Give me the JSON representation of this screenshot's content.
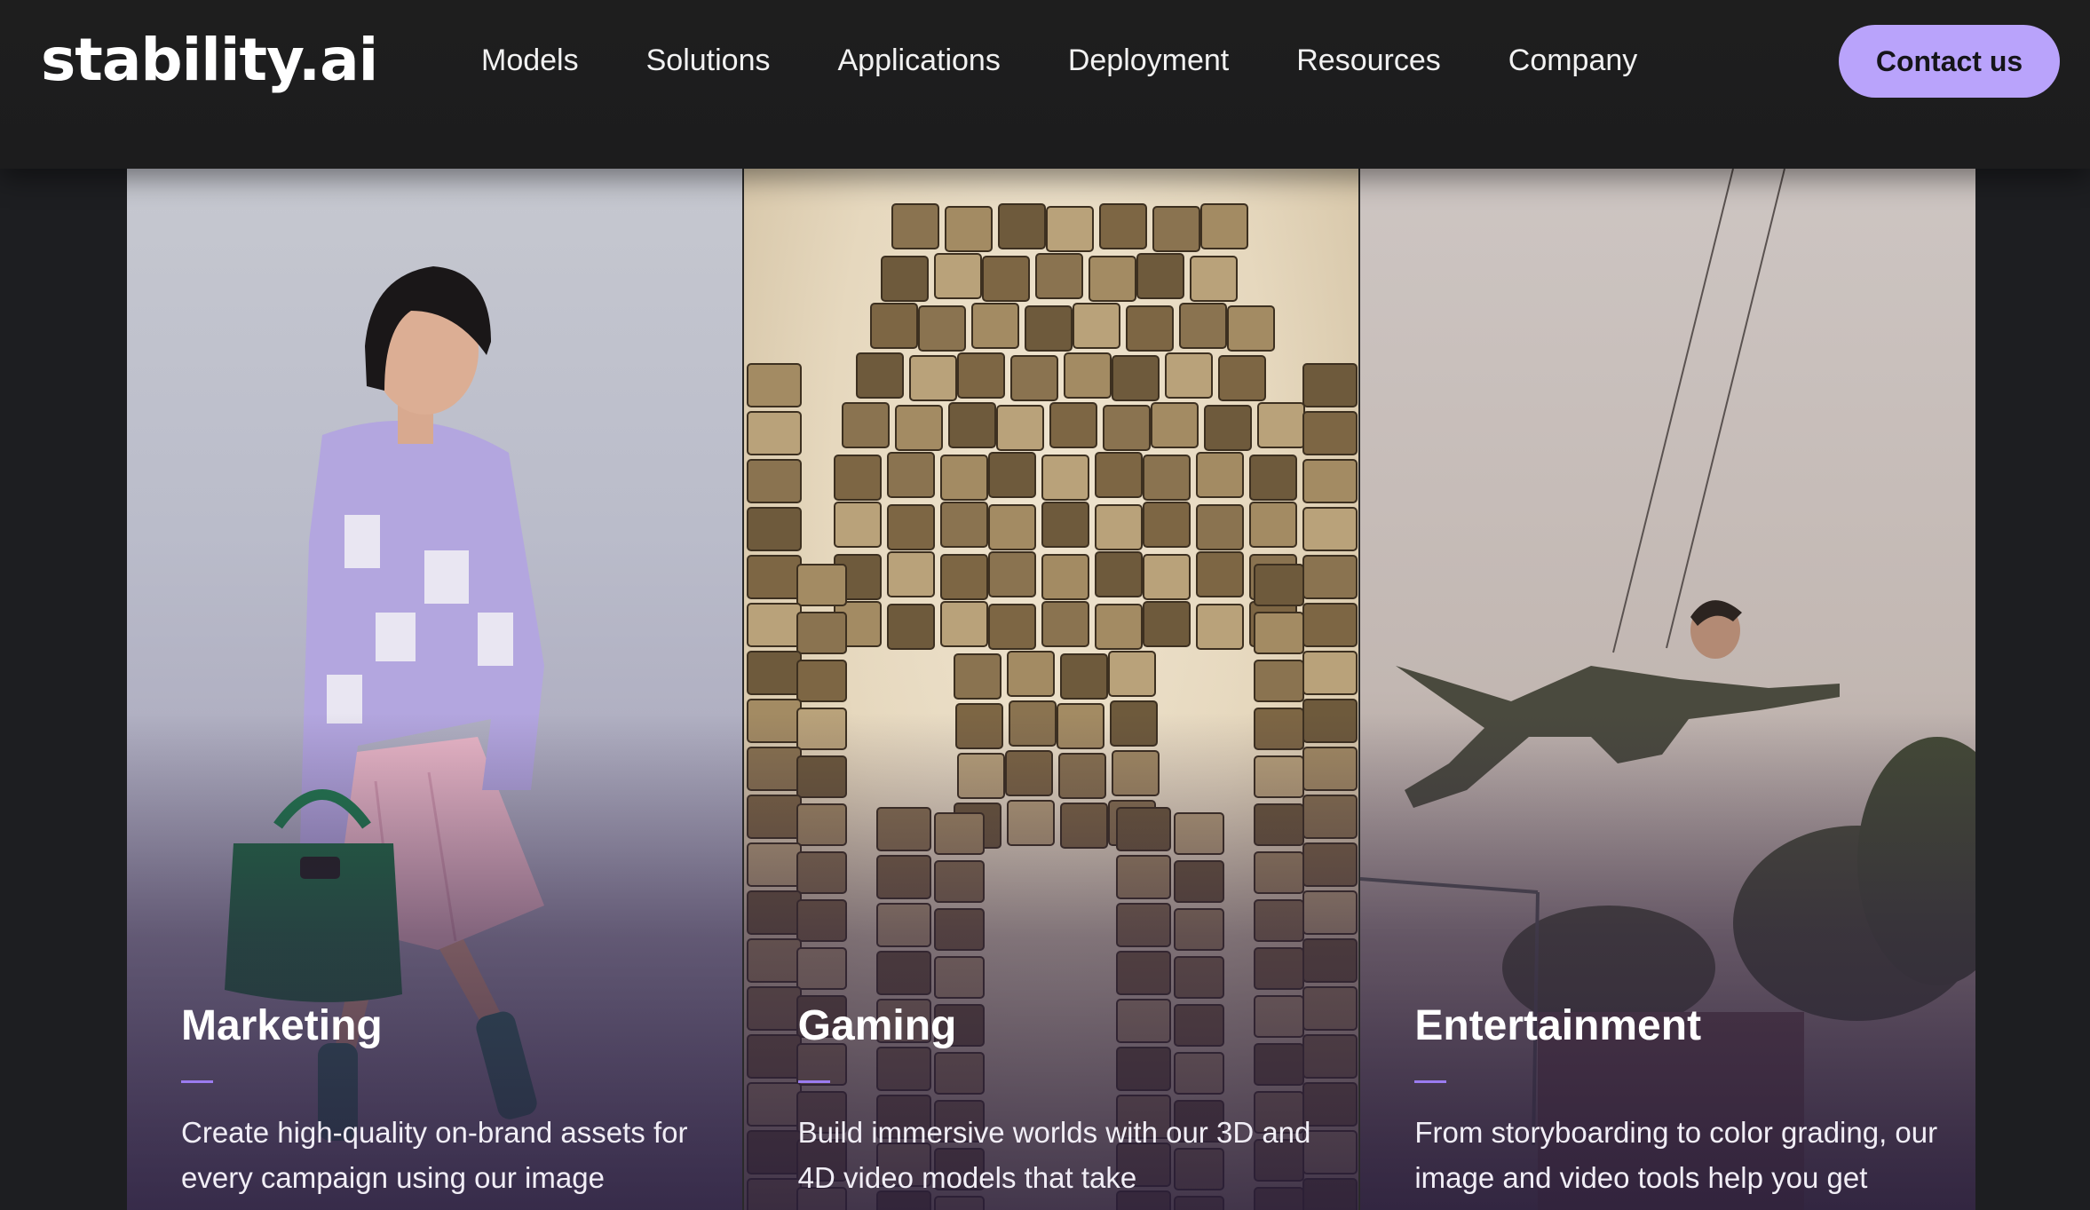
{
  "header": {
    "logo": "stability.ai",
    "nav": [
      "Models",
      "Solutions",
      "Applications",
      "Deployment",
      "Resources",
      "Company"
    ],
    "cta": "Contact us"
  },
  "colors": {
    "accent": "#b9a3fb",
    "rule": "#9b7cf0",
    "background": "#1d1e21"
  },
  "cards": [
    {
      "title": "Marketing",
      "description": "Create high-quality on-brand assets for every campaign using our image",
      "image": "woman-fashion-photo"
    },
    {
      "title": "Gaming",
      "description": "Build immersive worlds with our 3D and 4D video models that take",
      "image": "block-robot-sketch"
    },
    {
      "title": "Entertainment",
      "description": "From storyboarding to color grading, our image and video tools help you get",
      "image": "flying-stuntman-photo"
    }
  ]
}
